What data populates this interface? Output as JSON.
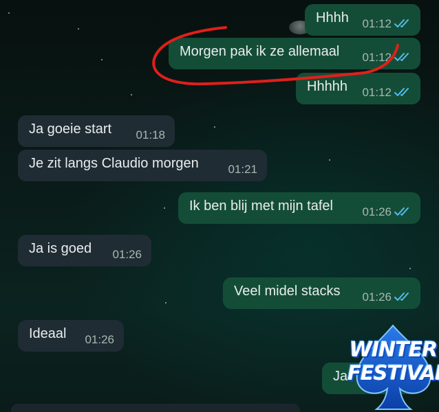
{
  "messages": [
    {
      "text": "Hhhh",
      "time": "01:12",
      "direction": "outgoing",
      "status": "read"
    },
    {
      "text": "Morgen pak ik ze allemaal",
      "time": "01:12",
      "direction": "outgoing",
      "status": "read"
    },
    {
      "text": "Hhhhh",
      "time": "01:12",
      "direction": "outgoing",
      "status": "read"
    },
    {
      "text": "Ja goeie start",
      "time": "01:18",
      "direction": "incoming"
    },
    {
      "text": "Je zit langs Claudio morgen",
      "time": "01:21",
      "direction": "incoming"
    },
    {
      "text": "Ik  ben blij met mijn tafel",
      "time": "01:26",
      "direction": "outgoing",
      "status": "read"
    },
    {
      "text": "Ja is goed",
      "time": "01:26",
      "direction": "incoming"
    },
    {
      "text": "Veel midel stacks",
      "time": "01:26",
      "direction": "outgoing",
      "status": "read"
    },
    {
      "text": "Ideaal",
      "time": "01:26",
      "direction": "incoming"
    },
    {
      "text": "Ja",
      "time": "",
      "direction": "outgoing",
      "status": "read"
    }
  ],
  "overlay_logo": {
    "line1": "WINTER",
    "line2": "FESTIVAL"
  },
  "colors": {
    "outgoing_bubble": "#144d37",
    "incoming_bubble": "#202c33",
    "read_ticks": "#53bdeb",
    "annotation_stroke": "#e0201a"
  },
  "icons": {
    "read_receipt": "double-check-icon"
  }
}
